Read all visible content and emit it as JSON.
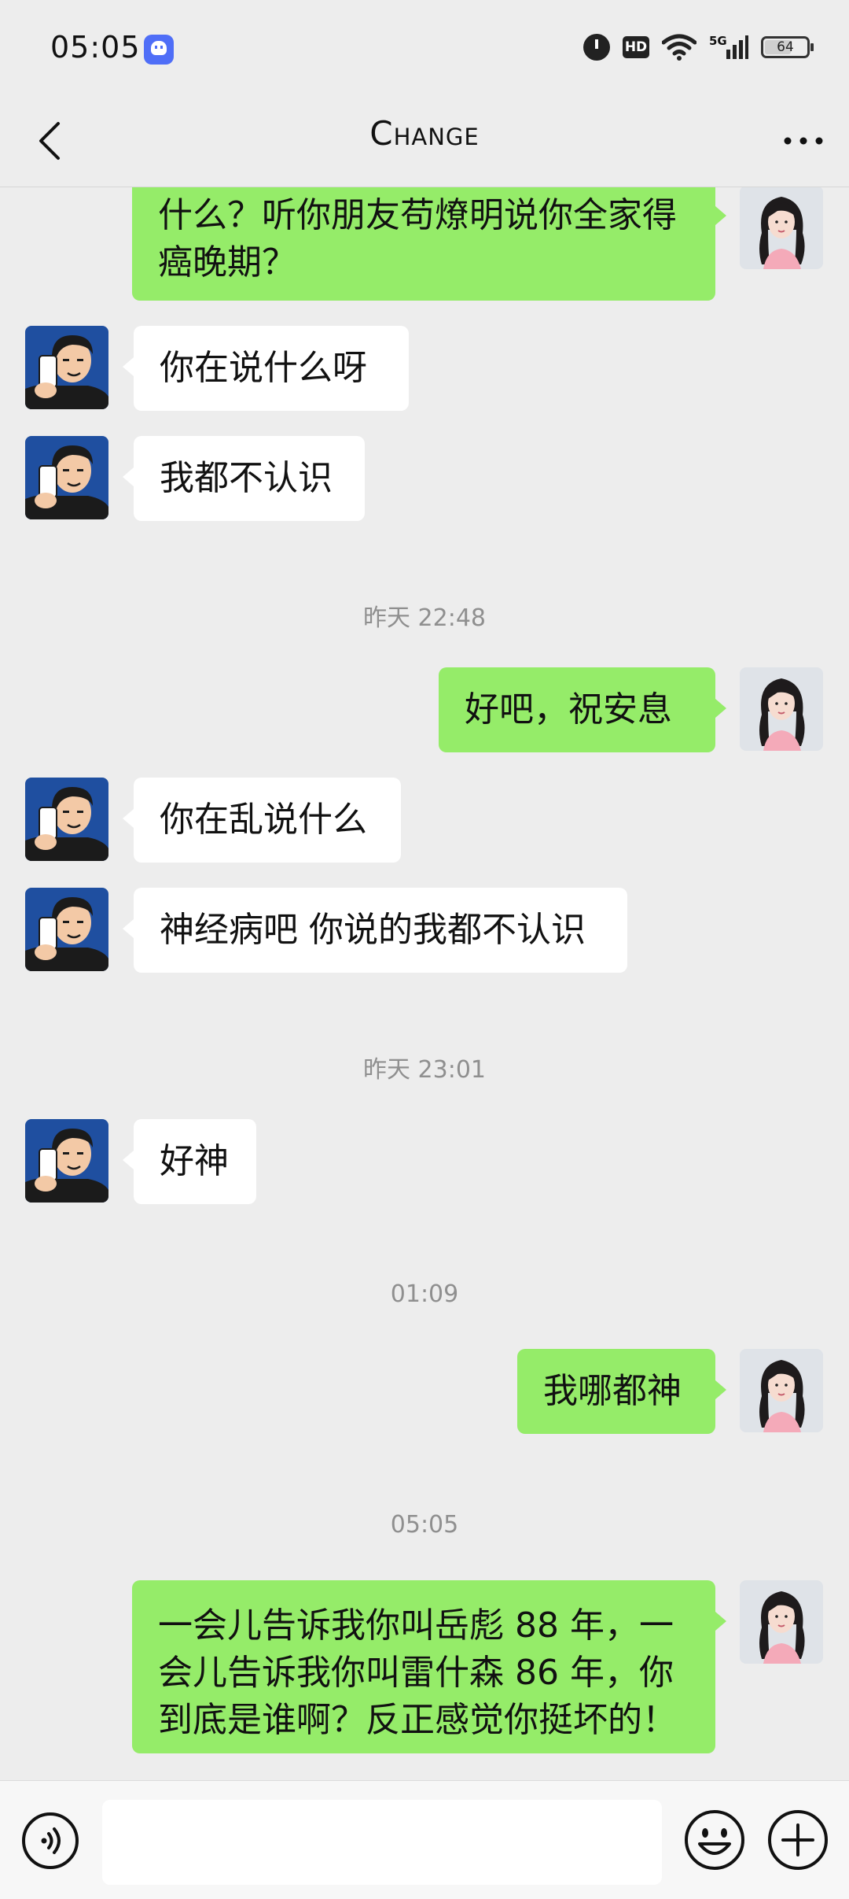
{
  "status_bar": {
    "time": "05:05",
    "app_icon": "qq-ghost-icon",
    "icons": [
      "alarm-icon",
      "hd-icon",
      "wifi-icon",
      "5g-signal-icon",
      "battery-icon"
    ],
    "hd_label": "HD",
    "network_label": "5G",
    "battery_level": "64",
    "battery_fraction": 0.64
  },
  "nav": {
    "title": "Change",
    "back_icon": "chevron-left-icon",
    "more_icon": "more-dots-icon"
  },
  "messages": [
    {
      "side": "mine",
      "text": "什么？听你朋友苟燎明说你全家得癌晚期？"
    },
    {
      "side": "theirs",
      "text": "你在说什么呀"
    },
    {
      "side": "theirs",
      "text": "我都不认识"
    },
    {
      "type": "timestamp",
      "text": "昨天 22:48"
    },
    {
      "side": "mine",
      "text": "好吧，祝安息"
    },
    {
      "side": "theirs",
      "text": "你在乱说什么"
    },
    {
      "side": "theirs",
      "text": "神经病吧 你说的我都不认识"
    },
    {
      "type": "timestamp",
      "text": "昨天 23:01"
    },
    {
      "side": "theirs",
      "text": "好神"
    },
    {
      "type": "timestamp",
      "text": "01:09"
    },
    {
      "side": "mine",
      "text": "我哪都神"
    },
    {
      "type": "timestamp",
      "text": "05:05"
    },
    {
      "side": "mine",
      "text": "一会儿告诉我你叫岳彪 88 年，一会儿告诉我你叫雷什森 86 年，你到底是谁啊？反正感觉你挺坏的！"
    }
  ],
  "bottom_bar": {
    "voice_icon": "voice-icon",
    "input_value": "",
    "emoji_icon": "emoji-icon",
    "plus_icon": "plus-icon"
  },
  "colors": {
    "background": "#ededed",
    "my_bubble": "#95ec69",
    "their_bubble": "#ffffff",
    "timestamp_text": "#8f8f8f"
  }
}
